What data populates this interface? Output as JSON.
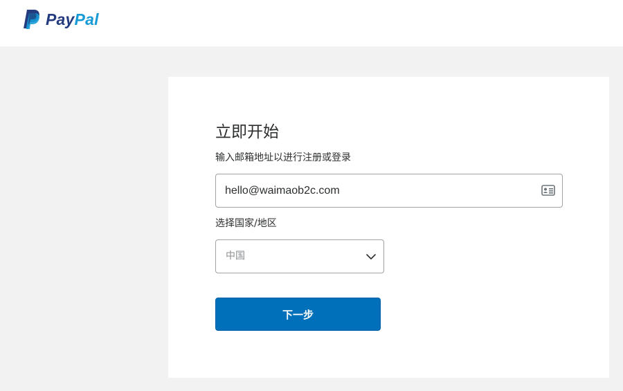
{
  "brand": {
    "name_part1": "Pay",
    "name_part2": "Pal",
    "color_dark": "#253b80",
    "color_light": "#179bd7"
  },
  "form": {
    "title": "立即开始",
    "subtitle": "输入邮箱地址以进行注册或登录",
    "email_value": "hello@waimaob2c.com",
    "email_icon": "contact-card-icon",
    "country_label": "选择国家/地区",
    "country_selected": "中国",
    "country_icon": "chevron-down-icon",
    "next_label": "下一步",
    "accent_color": "#0070ba"
  }
}
